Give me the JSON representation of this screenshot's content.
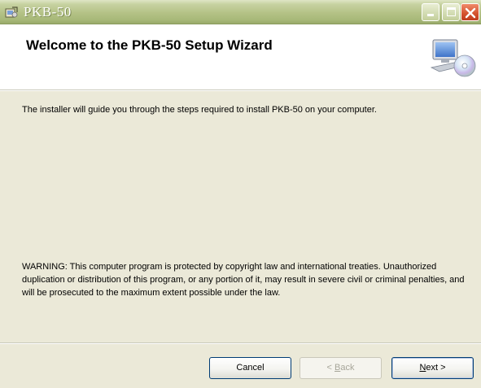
{
  "window": {
    "title": "PKB-50"
  },
  "banner": {
    "title": "Welcome to the PKB-50 Setup Wizard"
  },
  "body": {
    "intro": "The installer will guide you through the steps required to install PKB-50 on your computer.",
    "warning": "WARNING: This computer program is protected by copyright law and international treaties. Unauthorized duplication or distribution of this program, or any portion of it, may result in severe civil or criminal penalties, and will be prosecuted to the maximum extent possible under the law."
  },
  "buttons": {
    "cancel": "Cancel",
    "back_mnemonic": "B",
    "back_rest": "ack",
    "back_prefix": "< ",
    "next_mnemonic": "N",
    "next_rest": "ext >"
  },
  "icons": {
    "app": "installer-icon",
    "banner": "computer-cd-icon",
    "minimize": "minimize-icon",
    "maximize": "maximize-icon",
    "close": "close-icon"
  },
  "colors": {
    "titlebar": "#b4c286",
    "panel": "#ebe9d8",
    "close": "#d3522e"
  }
}
